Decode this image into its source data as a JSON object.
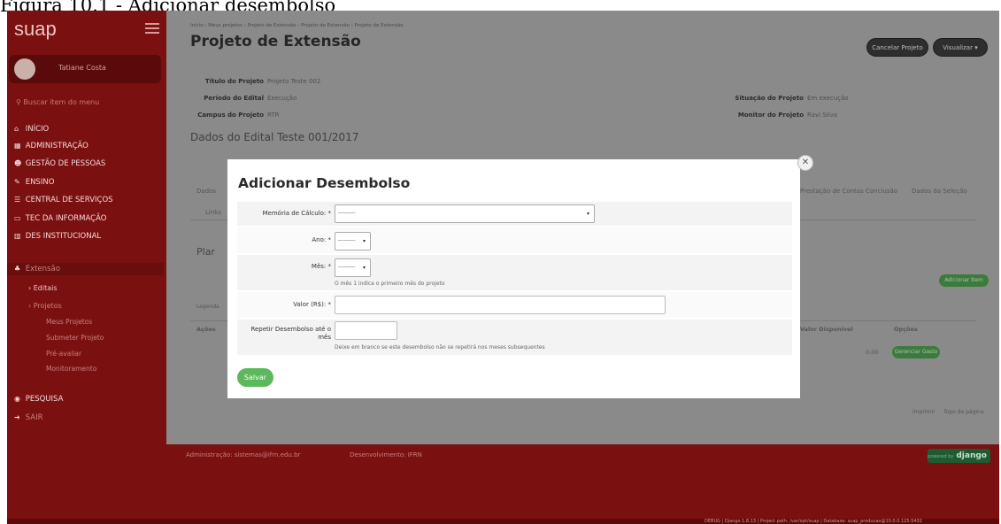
{
  "caption": "Figura 10.1 - Adicionar desembolso",
  "sidebar": {
    "logo": "suap",
    "user_name": "Tatiane Costa",
    "search_placeholder": "Buscar item do menu",
    "items": [
      {
        "label": "INÍCIO",
        "icon": "home-icon"
      },
      {
        "label": "ADMINISTRAÇÃO",
        "icon": "building-icon"
      },
      {
        "label": "GESTÃO DE PESSOAS",
        "icon": "people-icon"
      },
      {
        "label": "ENSINO",
        "icon": "pencil-icon"
      },
      {
        "label": "CENTRAL DE SERVIÇOS",
        "icon": "list-icon"
      },
      {
        "label": "TEC DA INFORMAÇÃO",
        "icon": "monitor-icon"
      },
      {
        "label": "DES INSTITUCIONAL",
        "icon": "chart-icon"
      },
      {
        "label": "Extensão",
        "icon": "extension-icon"
      }
    ],
    "sub_items": [
      "Editais",
      "Projetos"
    ],
    "project_items": [
      "Meus Projetos",
      "Submeter Projeto",
      "Pré-avaliar",
      "Monitoramento"
    ],
    "bottom_items": [
      {
        "label": "PESQUISA",
        "icon": "search-icon"
      },
      {
        "label": "SAIR",
        "icon": "logout-icon"
      }
    ]
  },
  "header": {
    "breadcrumb": "Início › Meus projetos › Projeto de Extensão › Projeto de Extensão › Projeto de Extensão",
    "title": "Projeto de Extensão",
    "cancel_button": "Cancelar Projeto",
    "view_button": "Visualizar ▾"
  },
  "details": {
    "titulo_label": "Título do Projeto",
    "titulo_value": "Projeto Teste 002",
    "periodo_label": "Período do Edital",
    "periodo_value": "Execução",
    "campus_label": "Campus do Projeto",
    "campus_value": "RTR",
    "situacao_label": "Situação do Projeto",
    "situacao_value": "Em execução",
    "monitor_label": "Monitor do Projeto",
    "monitor_value": "Ravi Silva"
  },
  "background": {
    "section_title": "Dados do Edital Teste 001/2017",
    "tabs_left": [
      "Dados",
      "Links"
    ],
    "tabs_right": [
      "Prestação de Contas",
      "Conclusão",
      "Dados da Seleção"
    ],
    "plan_heading": "Plar",
    "add_item": "Adicionar Item",
    "legend": "Legenda",
    "table_headers": [
      "Ações",
      "Valor Disponível",
      "Opções"
    ],
    "row_value": "0,00",
    "gerenciar": "Gerenciar Gasto",
    "footer_links": [
      "Imprimir",
      "Topo da página"
    ]
  },
  "modal": {
    "title": "Adicionar Desembolso",
    "fields": {
      "memoria_label": "Memória de Cálculo:",
      "memoria_value": "---------",
      "ano_label": "Ano:",
      "ano_value": "---------",
      "mes_label": "Mês:",
      "mes_value": "---------",
      "mes_help": "O mês 1 indica o primeiro mês do projeto",
      "valor_label": "Valor (R$):",
      "repetir_label_1": "Repetir Desembolso até o",
      "repetir_label_2": "mês",
      "repetir_help": "Deixe em branco se este desembolso não se repetirá nos meses subsequentes"
    },
    "required_mark": "*",
    "save_button": "Salvar",
    "close_icon": "✕"
  },
  "footer": {
    "admin_text": "Administração: sistemas@ifrn.edu.br",
    "dev_text": "Desenvolvimento: IFRN",
    "django_powered": "powered by",
    "django_label": "django",
    "debug_text": "DEBUG | Django 1.8.13 | Project path: /var/opt/suap | Database: suap_producao@10.0.0.125:5432"
  },
  "colors": {
    "sidebar_bg": "#7a1010",
    "overlay": "#8a8a8a",
    "save_green": "#5cb85c",
    "dark_button": "#2e2e2e"
  }
}
